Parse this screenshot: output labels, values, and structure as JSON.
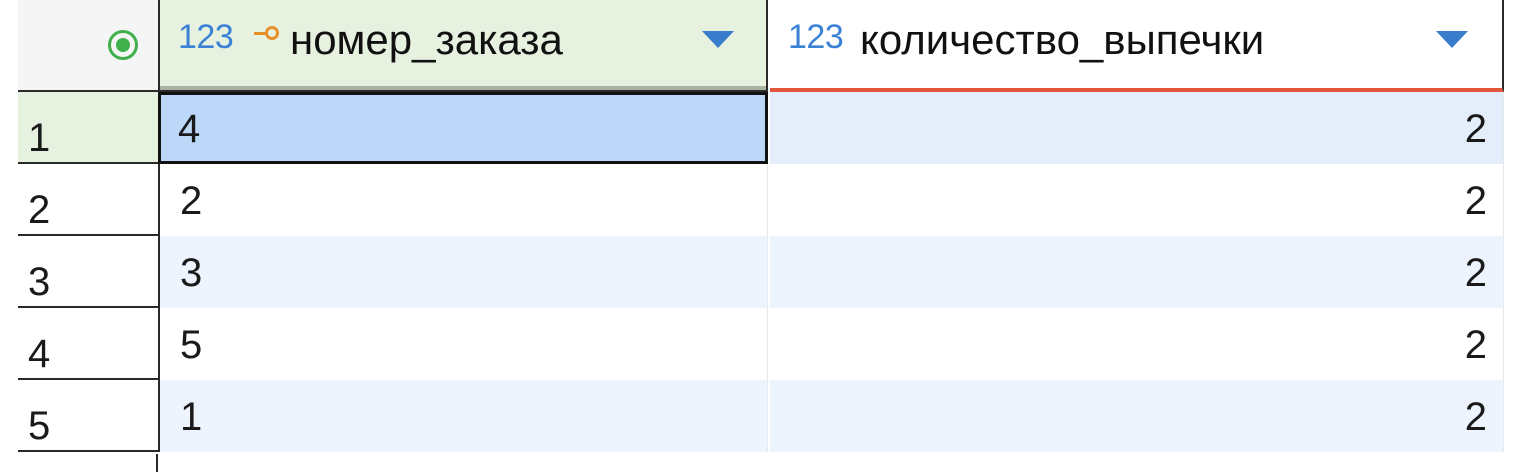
{
  "columns": [
    {
      "type": "123",
      "name": "номер_заказа",
      "primary_key": true
    },
    {
      "type": "123",
      "name": "количество_выпечки",
      "primary_key": false
    }
  ],
  "rows": [
    {
      "num": "1",
      "c1": "4",
      "c2": "2"
    },
    {
      "num": "2",
      "c1": "2",
      "c2": "2"
    },
    {
      "num": "3",
      "c1": "3",
      "c2": "2"
    },
    {
      "num": "4",
      "c1": "5",
      "c2": "2"
    },
    {
      "num": "5",
      "c1": "1",
      "c2": "2"
    }
  ],
  "colors": {
    "selected_header": "#e6f1df",
    "selected_cell": "#bdd7f8",
    "row_stripe": "#eef4fd",
    "sort_indicator": "#e2573b",
    "type_label": "#3b82d6",
    "key_icon": "#e6902a",
    "record_icon": "#3fb04a"
  },
  "icons": {
    "corner": "record-mode-icon",
    "key": "primary-key-icon",
    "sort": "sort-dropdown-icon"
  }
}
